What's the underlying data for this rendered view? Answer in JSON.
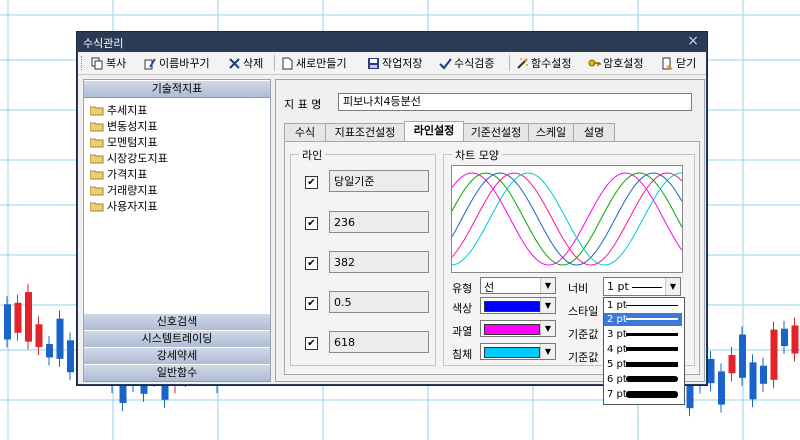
{
  "window": {
    "title": "수식관리",
    "close_glyph": "×"
  },
  "toolbar": {
    "copy": "복사",
    "rename": "이름바꾸기",
    "delete": "삭제",
    "new": "새로만들기",
    "save_work": "작업저장",
    "verify": "수식검증",
    "func_desc": "함수설정",
    "password": "암호설정",
    "close": "닫기"
  },
  "left_panel": {
    "header": "기술적지표",
    "items": [
      "추세지표",
      "변동성지표",
      "모멘텀지표",
      "시장강도지표",
      "가격지표",
      "거래량지표",
      "사용자지표"
    ],
    "bottom_sections": [
      "신호검색",
      "시스템트레이딩",
      "강세약세",
      "일반함수"
    ]
  },
  "indicator": {
    "name_label": "지 표 명",
    "name_value": "피보나치4등분선"
  },
  "tabs": [
    {
      "label": "수식",
      "active": false
    },
    {
      "label": "지표조건설정",
      "active": false
    },
    {
      "label": "라인설정",
      "active": true
    },
    {
      "label": "기준선설정",
      "active": false
    },
    {
      "label": "스케일",
      "active": false
    },
    {
      "label": "설명",
      "active": false
    }
  ],
  "lines_group": {
    "title": "라인",
    "lines": [
      {
        "label": "당일기준",
        "checked": true
      },
      {
        "label": "236",
        "checked": true
      },
      {
        "label": "382",
        "checked": true
      },
      {
        "label": "0.5",
        "checked": true
      },
      {
        "label": "618",
        "checked": true
      }
    ]
  },
  "chart_shape": {
    "title": "차트 모양"
  },
  "props": {
    "type_label": "유형",
    "type_value": "선",
    "color_label": "색상",
    "color_value": "#0000ff",
    "overbought_label": "과열",
    "overbought_color": "#ff00ff",
    "oversold_label": "침체",
    "oversold_color": "#00ccff",
    "width_label": "너비",
    "width_value": "1 pt",
    "style_label": "스타일",
    "base1_label": "기준값",
    "base2_label": "기준값"
  },
  "width_dropdown": {
    "options": [
      "1 pt",
      "2 pt",
      "3 pt",
      "4 pt",
      "5 pt",
      "6 pt",
      "7 pt"
    ],
    "selected": "2 pt"
  },
  "colors": {
    "title_bar": "#2b3a55",
    "selection": "#3b78d8",
    "candle_up": "#e0242a",
    "candle_down": "#1a63c9"
  }
}
